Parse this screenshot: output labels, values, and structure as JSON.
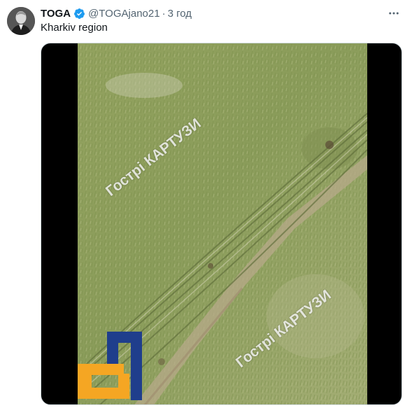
{
  "post": {
    "author_name": "TOGA",
    "handle": "@TOGAjano21",
    "separator": "·",
    "time": "3 год",
    "text": "Kharkiv region"
  },
  "media": {
    "watermark_text": "Гострі КАРТУЗИ",
    "logo_colors": {
      "blue": "#1f3e8c",
      "orange": "#f5a623"
    }
  },
  "colors": {
    "verified": "#1d9bf0",
    "field_green": "#8fa05f",
    "letterbox": "#000000"
  },
  "icons": [
    "verified-badge-icon",
    "more-options-icon"
  ]
}
